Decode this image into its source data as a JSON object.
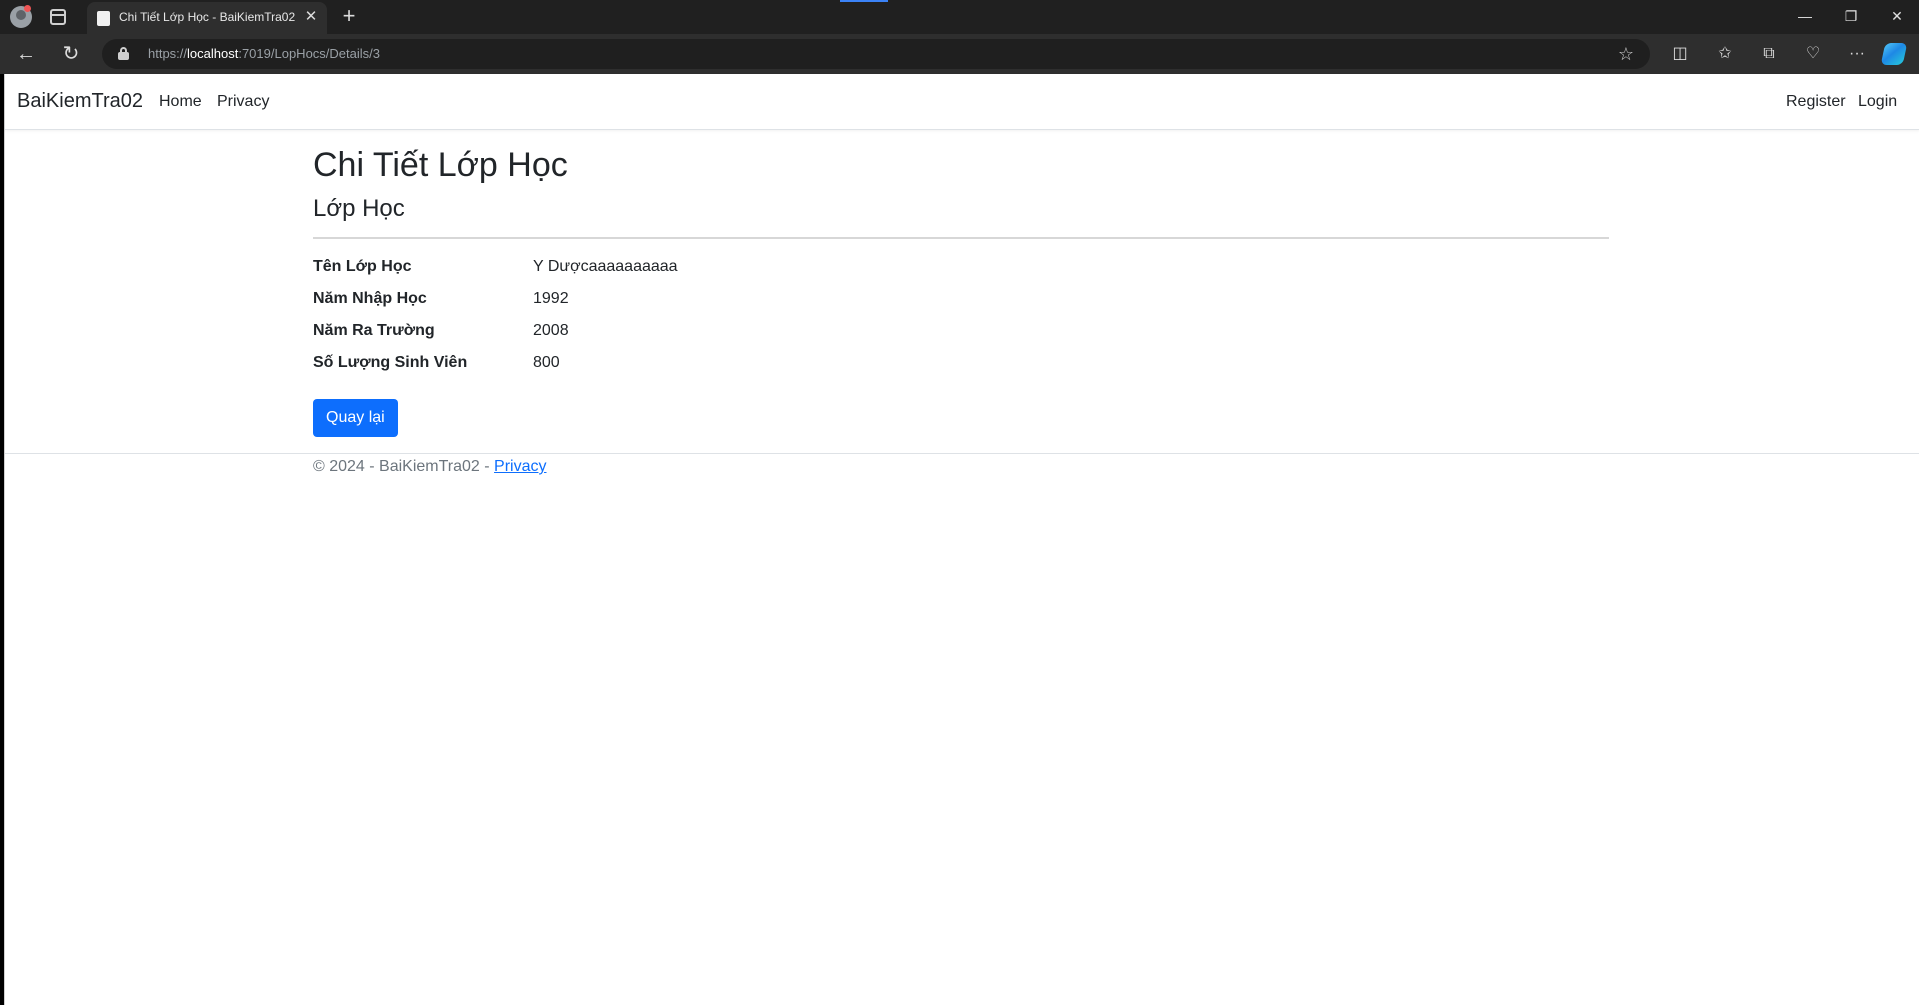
{
  "browser": {
    "tab_title": "Chi Tiết Lớp Học - BaiKiemTra02",
    "url_prefix": "https://",
    "url_host": "localhost",
    "url_path": ":7019/LopHocs/Details/3"
  },
  "navbar": {
    "brand": "BaiKiemTra02",
    "links": [
      "Home",
      "Privacy"
    ],
    "right_links": [
      "Register",
      "Login"
    ]
  },
  "page": {
    "title": "Chi Tiết Lớp Học",
    "subtitle": "Lớp Học",
    "fields": [
      {
        "label": "Tên Lớp Học",
        "value": "Y Dượcaaaaaaaaaa"
      },
      {
        "label": "Năm Nhập Học",
        "value": "1992"
      },
      {
        "label": "Năm Ra Trường",
        "value": "2008"
      },
      {
        "label": "Số Lượng Sinh Viên",
        "value": "800"
      }
    ],
    "back_button": "Quay lại"
  },
  "footer": {
    "text": "© 2024 - BaiKiemTra02 - ",
    "link": "Privacy"
  },
  "colors": {
    "primary": "#0d6efd",
    "chrome_dark": "#202020",
    "chrome_toolbar": "#2e2e2e"
  }
}
